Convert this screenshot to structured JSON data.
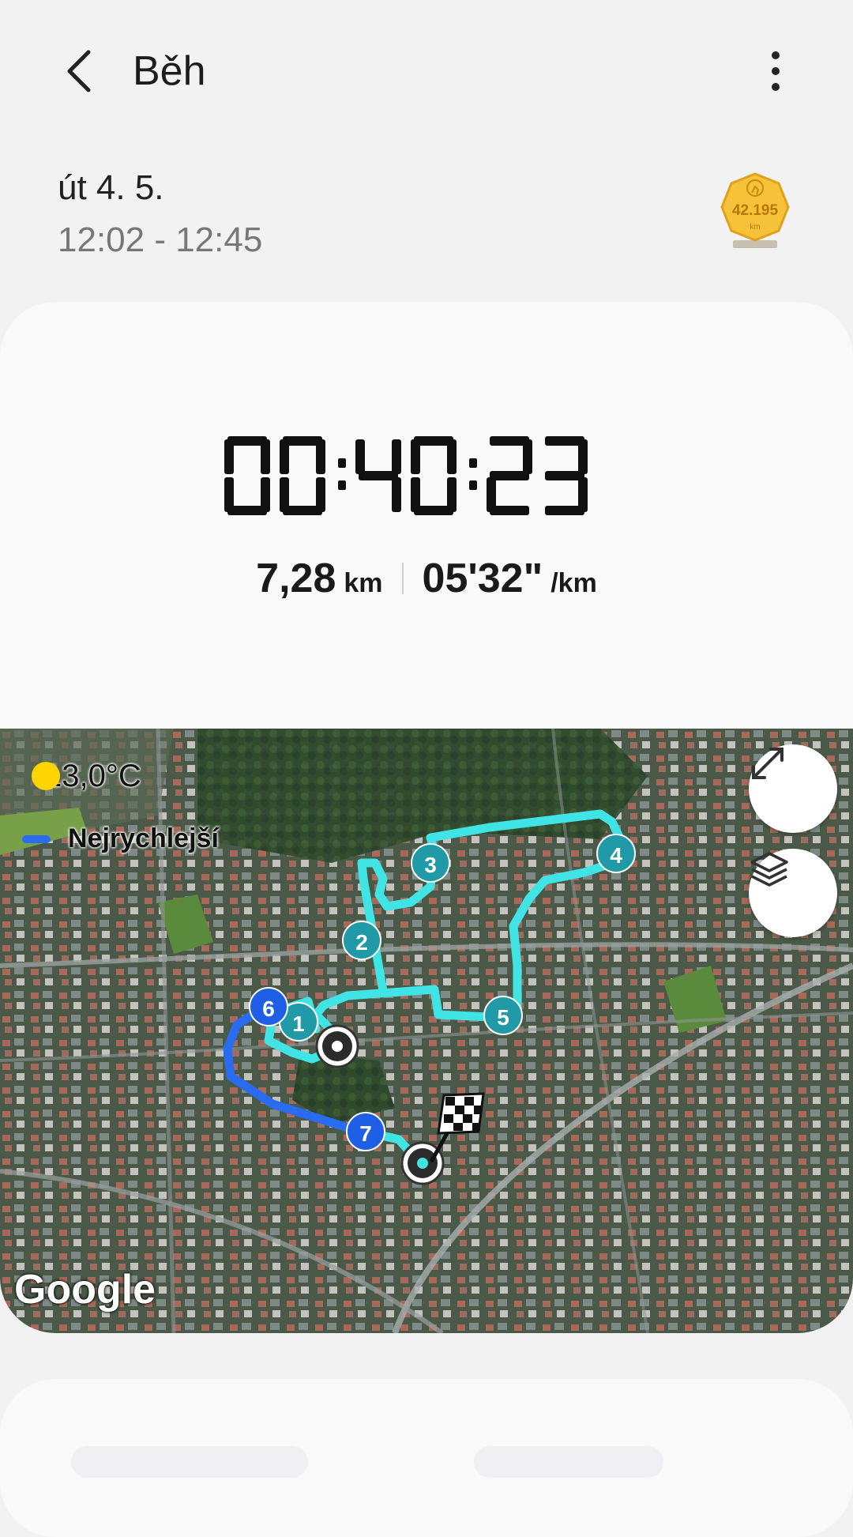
{
  "header": {
    "title": "Běh"
  },
  "session": {
    "date": "út 4. 5.",
    "time_range": "12:02 - 12:45"
  },
  "badge": {
    "value": "42.195",
    "unit": "km"
  },
  "summary": {
    "duration": "00:40:23",
    "distance_value": "7,28",
    "distance_unit": "km",
    "pace_value": "05'32\"",
    "pace_unit": "/km"
  },
  "map": {
    "weather_temp": "13,0°C",
    "legend_label": "Nejrychlejší",
    "markers": [
      "1",
      "2",
      "3",
      "4",
      "5",
      "6",
      "7"
    ],
    "attribution": "Google",
    "colors": {
      "route": "#3fe3e3",
      "fastest": "#2a6cf0",
      "marker": "#1f9aa6"
    }
  },
  "icons": {
    "back": "chevron-left-icon",
    "more": "more-vertical-icon",
    "expand": "expand-icon",
    "layers": "layers-icon",
    "sun": "sun-icon",
    "finish": "checkered-flag-icon",
    "start": "start-point-icon"
  }
}
